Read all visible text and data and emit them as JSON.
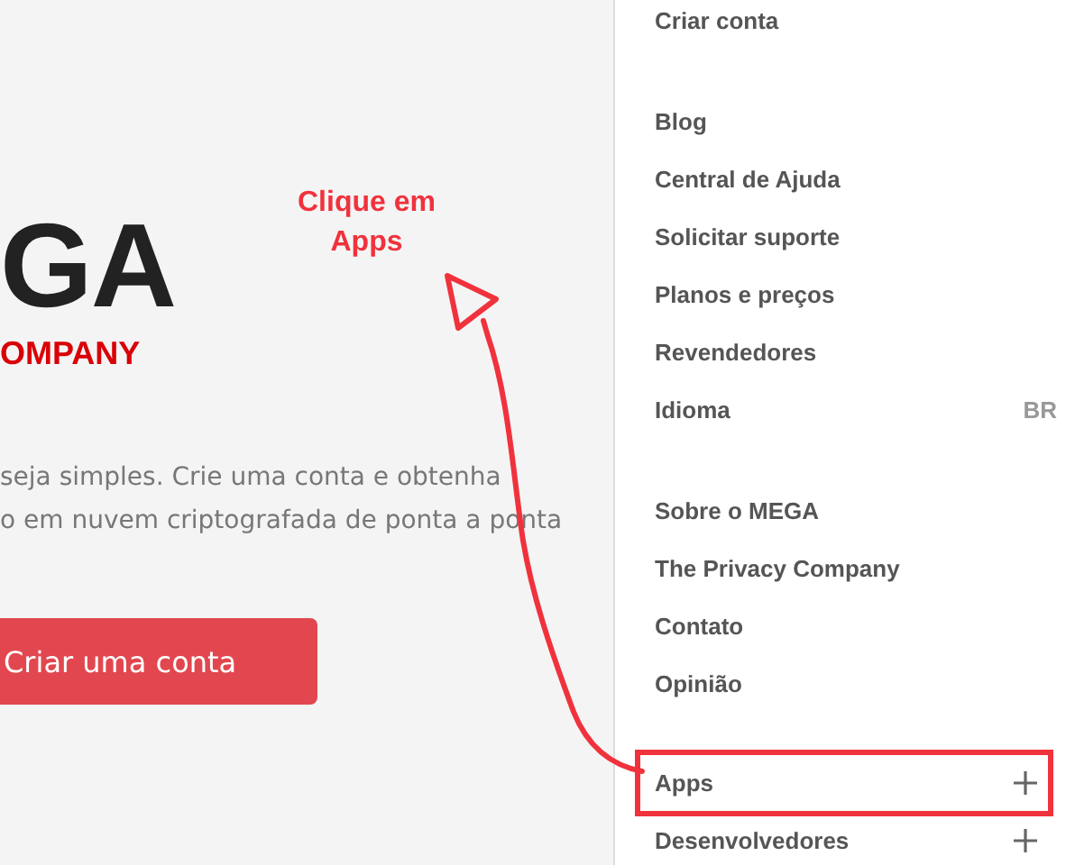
{
  "hero": {
    "logo_word": "GA",
    "logo_tagline": "OMPANY",
    "text_lines": [
      "seja simples. Crie uma conta e obtenha",
      "o em nuvem criptografada de ponta a ponta"
    ],
    "cta_button": "Criar uma conta"
  },
  "annotation": {
    "text_lines": [
      "Clique em",
      "Apps"
    ]
  },
  "menu": {
    "groups": [
      [
        {
          "label": "Criar conta",
          "kind": "link"
        }
      ],
      [
        {
          "label": "Blog",
          "kind": "link"
        },
        {
          "label": "Central de Ajuda",
          "kind": "link"
        },
        {
          "label": "Solicitar suporte",
          "kind": "link"
        },
        {
          "label": "Planos e preços",
          "kind": "link"
        },
        {
          "label": "Revendedores",
          "kind": "link"
        },
        {
          "label": "Idioma",
          "kind": "value",
          "value": "BR"
        }
      ],
      [
        {
          "label": "Sobre o MEGA",
          "kind": "link"
        },
        {
          "label": "The Privacy Company",
          "kind": "link"
        },
        {
          "label": "Contato",
          "kind": "link"
        },
        {
          "label": "Opinião",
          "kind": "link"
        }
      ],
      [
        {
          "label": "Apps",
          "kind": "expandable",
          "highlighted": true
        },
        {
          "label": "Desenvolvedores",
          "kind": "expandable",
          "highlighted": false
        }
      ]
    ]
  }
}
